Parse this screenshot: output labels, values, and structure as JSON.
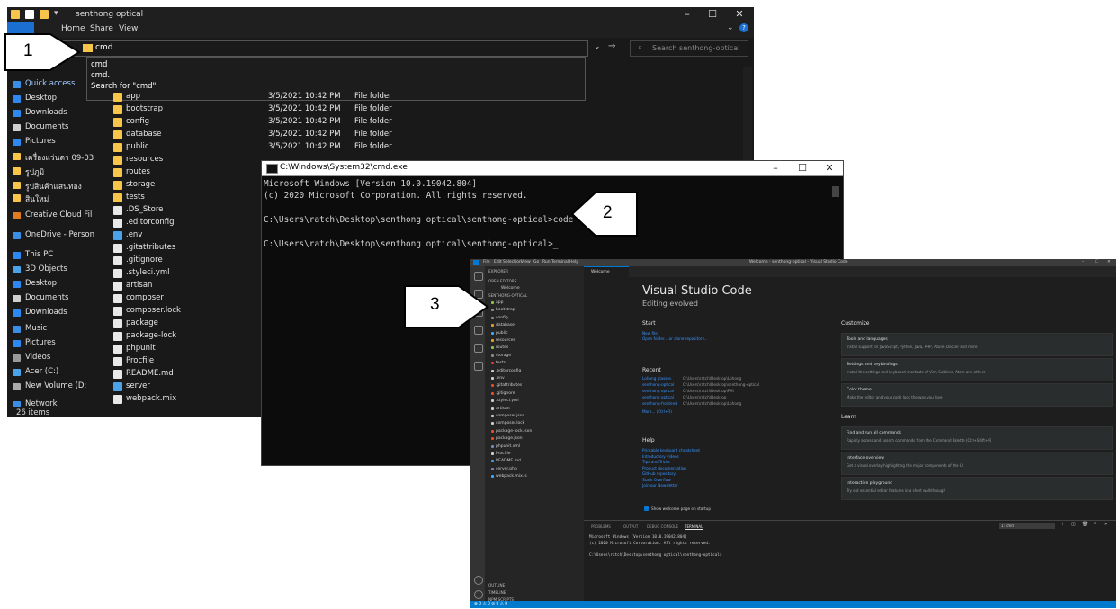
{
  "explorer": {
    "title": "senthong optical",
    "ribbon_tabs": [
      "File",
      "Home",
      "Share",
      "View"
    ],
    "address_value": "cmd",
    "search_placeholder": "Search senthong-optical",
    "autocomplete": [
      "cmd",
      "cmd.",
      "Search for \"cmd\""
    ],
    "nav_items": [
      {
        "label": "Quick access",
        "icon": "star-icon",
        "color": "#3a8ee6"
      },
      {
        "label": "Desktop",
        "icon": "desktop-icon",
        "color": "#2d89ef"
      },
      {
        "label": "Downloads",
        "icon": "download-icon",
        "color": "#2d89ef"
      },
      {
        "label": "Documents",
        "icon": "document-icon",
        "color": "#cfcfcf"
      },
      {
        "label": "Pictures",
        "icon": "picture-icon",
        "color": "#2d89ef"
      },
      {
        "label": "เครื่องแว่นตา 09-03",
        "icon": "folder-icon",
        "color": "#f7c54a"
      },
      {
        "label": "รูปภูมิ",
        "icon": "folder-icon",
        "color": "#f7c54a"
      },
      {
        "label": "รูปสินค้าแสนทอง",
        "icon": "folder-icon",
        "color": "#f7c54a"
      },
      {
        "label": "สินใหม่",
        "icon": "folder-icon",
        "color": "#f7c54a"
      },
      {
        "label": "Creative Cloud Fil",
        "icon": "creative-cloud-icon",
        "color": "#e07b24"
      },
      {
        "label": "OneDrive - Person",
        "icon": "onedrive-icon",
        "color": "#3a8ee6"
      },
      {
        "label": "This PC",
        "icon": "pc-icon",
        "color": "#2d89ef"
      },
      {
        "label": "3D Objects",
        "icon": "cube-icon",
        "color": "#4aa3e8"
      },
      {
        "label": "Desktop",
        "icon": "desktop-icon",
        "color": "#2d89ef"
      },
      {
        "label": "Documents",
        "icon": "document-icon",
        "color": "#cfcfcf"
      },
      {
        "label": "Downloads",
        "icon": "download-icon",
        "color": "#2d89ef"
      },
      {
        "label": "Music",
        "icon": "music-icon",
        "color": "#3a8ee6"
      },
      {
        "label": "Pictures",
        "icon": "picture-icon",
        "color": "#2d89ef"
      },
      {
        "label": "Videos",
        "icon": "video-icon",
        "color": "#999999"
      },
      {
        "label": "Acer (C:)",
        "icon": "drive-icon",
        "color": "#4aa3e8"
      },
      {
        "label": "New Volume (D:",
        "icon": "drive-icon",
        "color": "#aaaaaa"
      },
      {
        "label": "Network",
        "icon": "network-icon",
        "color": "#3a8ee6"
      }
    ],
    "files": [
      {
        "name": "app",
        "date": "3/5/2021 10:42 PM",
        "type": "File folder",
        "color": "#f7c54a"
      },
      {
        "name": "bootstrap",
        "date": "3/5/2021 10:42 PM",
        "type": "File folder",
        "color": "#f7c54a"
      },
      {
        "name": "config",
        "date": "3/5/2021 10:42 PM",
        "type": "File folder",
        "color": "#f7c54a"
      },
      {
        "name": "database",
        "date": "3/5/2021 10:42 PM",
        "type": "File folder",
        "color": "#f7c54a"
      },
      {
        "name": "public",
        "date": "3/5/2021 10:42 PM",
        "type": "File folder",
        "color": "#f7c54a"
      },
      {
        "name": "resources",
        "date": "",
        "type": "",
        "color": "#f7c54a"
      },
      {
        "name": "routes",
        "date": "",
        "type": "",
        "color": "#f7c54a"
      },
      {
        "name": "storage",
        "date": "",
        "type": "",
        "color": "#f7c54a"
      },
      {
        "name": "tests",
        "date": "",
        "type": "",
        "color": "#f7c54a"
      },
      {
        "name": ".DS_Store",
        "date": "",
        "type": "",
        "color": "#e8e8e8"
      },
      {
        "name": ".editorconfig",
        "date": "",
        "type": "",
        "color": "#e8e8e8"
      },
      {
        "name": ".env",
        "date": "",
        "type": "",
        "color": "#4aa3e8"
      },
      {
        "name": ".gitattributes",
        "date": "",
        "type": "",
        "color": "#e8e8e8"
      },
      {
        "name": ".gitignore",
        "date": "",
        "type": "",
        "color": "#e8e8e8"
      },
      {
        "name": ".styleci.yml",
        "date": "",
        "type": "",
        "color": "#e8e8e8"
      },
      {
        "name": "artisan",
        "date": "",
        "type": "",
        "color": "#e8e8e8"
      },
      {
        "name": "composer",
        "date": "",
        "type": "",
        "color": "#e8e8e8"
      },
      {
        "name": "composer.lock",
        "date": "",
        "type": "",
        "color": "#e8e8e8"
      },
      {
        "name": "package",
        "date": "",
        "type": "",
        "color": "#e8e8e8"
      },
      {
        "name": "package-lock",
        "date": "",
        "type": "",
        "color": "#e8e8e8"
      },
      {
        "name": "phpunit",
        "date": "",
        "type": "",
        "color": "#e8e8e8"
      },
      {
        "name": "Procfile",
        "date": "",
        "type": "",
        "color": "#e8e8e8"
      },
      {
        "name": "README.md",
        "date": "",
        "type": "",
        "color": "#e8e8e8"
      },
      {
        "name": "server",
        "date": "",
        "type": "",
        "color": "#4aa3e8"
      },
      {
        "name": "webpack.mix",
        "date": "",
        "type": "",
        "color": "#e8e8e8"
      }
    ],
    "status": "26 items"
  },
  "cmd": {
    "title": "C:\\Windows\\System32\\cmd.exe",
    "lines": [
      "Microsoft Windows [Version 10.0.19042.804]",
      "(c) 2020 Microsoft Corporation. All rights reserved.",
      "",
      "C:\\Users\\ratch\\Desktop\\senthong optical\\senthong-optical>code .",
      "",
      "C:\\Users\\ratch\\Desktop\\senthong optical\\senthong-optical>_"
    ]
  },
  "vscode": {
    "menu": [
      "File",
      "Edit",
      "Selection",
      "View",
      "Go",
      "Run",
      "Terminal",
      "Help"
    ],
    "window_title": "Welcome - senthong-optical - Visual Studio Code",
    "sidebar_header": "EXPLORER",
    "open_editors": "OPEN EDITORS",
    "open_editor_item": "Welcome",
    "project": "SENTHONG-OPTICAL",
    "tree": [
      {
        "name": "app",
        "color": "#8dc149"
      },
      {
        "name": "bootstrap",
        "color": "#8a8a8a"
      },
      {
        "name": "config",
        "color": "#8a8a8a"
      },
      {
        "name": "database",
        "color": "#e0a030"
      },
      {
        "name": "public",
        "color": "#42a5f5"
      },
      {
        "name": "resources",
        "color": "#e0a030"
      },
      {
        "name": "routes",
        "color": "#8dc149"
      },
      {
        "name": "storage",
        "color": "#8a8a8a"
      },
      {
        "name": "tests",
        "color": "#e53935"
      },
      {
        "name": ".editorconfig",
        "color": "#cccccc"
      },
      {
        "name": ".env",
        "color": "#cccccc"
      },
      {
        "name": ".gitattributes",
        "color": "#e44d26"
      },
      {
        "name": ".gitignore",
        "color": "#e44d26"
      },
      {
        "name": ".styleci.yml",
        "color": "#cccccc"
      },
      {
        "name": "artisan",
        "color": "#cccccc"
      },
      {
        "name": "composer.json",
        "color": "#cccccc"
      },
      {
        "name": "composer.lock",
        "color": "#cccccc"
      },
      {
        "name": "package-lock.json",
        "color": "#e44d26"
      },
      {
        "name": "package.json",
        "color": "#e44d26"
      },
      {
        "name": "phpunit.xml",
        "color": "#7a86b8"
      },
      {
        "name": "Procfile",
        "color": "#cccccc"
      },
      {
        "name": "README.md",
        "color": "#42a5f5"
      },
      {
        "name": "server.php",
        "color": "#7a86b8"
      },
      {
        "name": "webpack.mix.js",
        "color": "#42a5f5"
      }
    ],
    "outline": "OUTLINE",
    "timeline": "TIMELINE",
    "npm_scripts": "NPM SCRIPTS",
    "tab_label": "Welcome",
    "welcome_title": "Visual Studio Code",
    "welcome_subtitle": "Editing evolved",
    "start_heading": "Start",
    "start_links": [
      "New file",
      "Open folder... or clone repository..."
    ],
    "recent_heading": "Recent",
    "recent": [
      {
        "name": "Lohong glasses",
        "path": "C:\\Users\\ratch\\Desktop\\Lohong"
      },
      {
        "name": "senthong-optical",
        "path": "C:\\Users\\ratch\\Desktop\\senthong-optical"
      },
      {
        "name": "senthong optical",
        "path": "C:\\Users\\ratch\\Desktop\\PHI"
      },
      {
        "name": "senthong optical",
        "path": "C:\\Users\\ratch\\Desktop"
      },
      {
        "name": "senthong-frontend",
        "path": "C:\\Users\\ratch\\Desktop\\Lohong"
      }
    ],
    "recent_more": "More...   (Ctrl+R)",
    "help_heading": "Help",
    "help_links": [
      "Printable keyboard cheatsheet",
      "Introductory videos",
      "Tips and Tricks",
      "Product documentation",
      "GitHub repository",
      "Stack Overflow",
      "Join our Newsletter"
    ],
    "customize_heading": "Customize",
    "customize_cards": [
      {
        "title": "Tools and languages",
        "desc": "Install support for JavaScript, Python, Java, PHP, Azure, Docker and more"
      },
      {
        "title": "Settings and keybindings",
        "desc": "Install the settings and keyboard shortcuts of Vim, Sublime, Atom and others"
      },
      {
        "title": "Color theme",
        "desc": "Make the editor and your code look the way you love"
      }
    ],
    "learn_heading": "Learn",
    "learn_cards": [
      {
        "title": "Find and run all commands",
        "desc": "Rapidly access and search commands from the Command Palette (Ctrl+Shift+P)"
      },
      {
        "title": "Interface overview",
        "desc": "Get a visual overlay highlighting the major components of the UI"
      },
      {
        "title": "Interactive playground",
        "desc": "Try out essential editor features in a short walkthrough"
      }
    ],
    "show_welcome": "Show welcome page on startup",
    "panel_tabs": [
      "PROBLEMS",
      "OUTPUT",
      "DEBUG CONSOLE",
      "TERMINAL"
    ],
    "terminal_select": "1: cmd",
    "terminal_lines": [
      "Microsoft Windows [Version 10.0.19042.804]",
      "(c) 2020 Microsoft Corporation. All rights reserved.",
      "",
      "C:\\Users\\ratch\\Desktop\\senthong optical\\senthong-optical>"
    ],
    "status_left": "⊗ 0 ⚠ 0   ⊘ 0 ⚠ 0"
  },
  "callouts": [
    "1",
    "2",
    "3"
  ],
  "colors": {
    "explorer_bg": "#191919",
    "folder": "#f7c54a",
    "accent_blue": "#1b6fd1",
    "vscode_status": "#007acc",
    "link": "#3794ff"
  }
}
